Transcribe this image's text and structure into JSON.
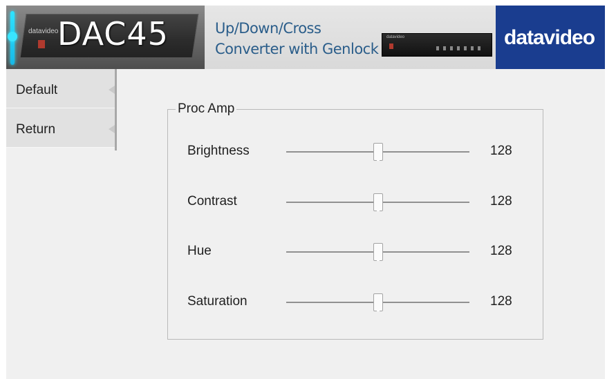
{
  "banner": {
    "product": "DAC45",
    "subtitle_line1": "Up/Down/Cross",
    "subtitle_line2": "Converter with Genlock",
    "brand": "datavideo",
    "device_brand_small": "datavideo"
  },
  "sidebar": {
    "items": [
      {
        "label": "Default"
      },
      {
        "label": "Return"
      }
    ]
  },
  "proc_amp": {
    "title": "Proc Amp",
    "controls": [
      {
        "label": "Brightness",
        "value": "128",
        "fraction": 0.5
      },
      {
        "label": "Contrast",
        "value": "128",
        "fraction": 0.5
      },
      {
        "label": "Hue",
        "value": "128",
        "fraction": 0.5
      },
      {
        "label": "Saturation",
        "value": "128",
        "fraction": 0.5
      }
    ]
  },
  "colors": {
    "banner_brand_bg": "#1a3d8f",
    "accent_cyan": "#2fe3ff",
    "subtitle_text": "#2a5d8a"
  },
  "icons": [
    "sidebar-notch-icon",
    "slider-thumb-icon"
  ]
}
